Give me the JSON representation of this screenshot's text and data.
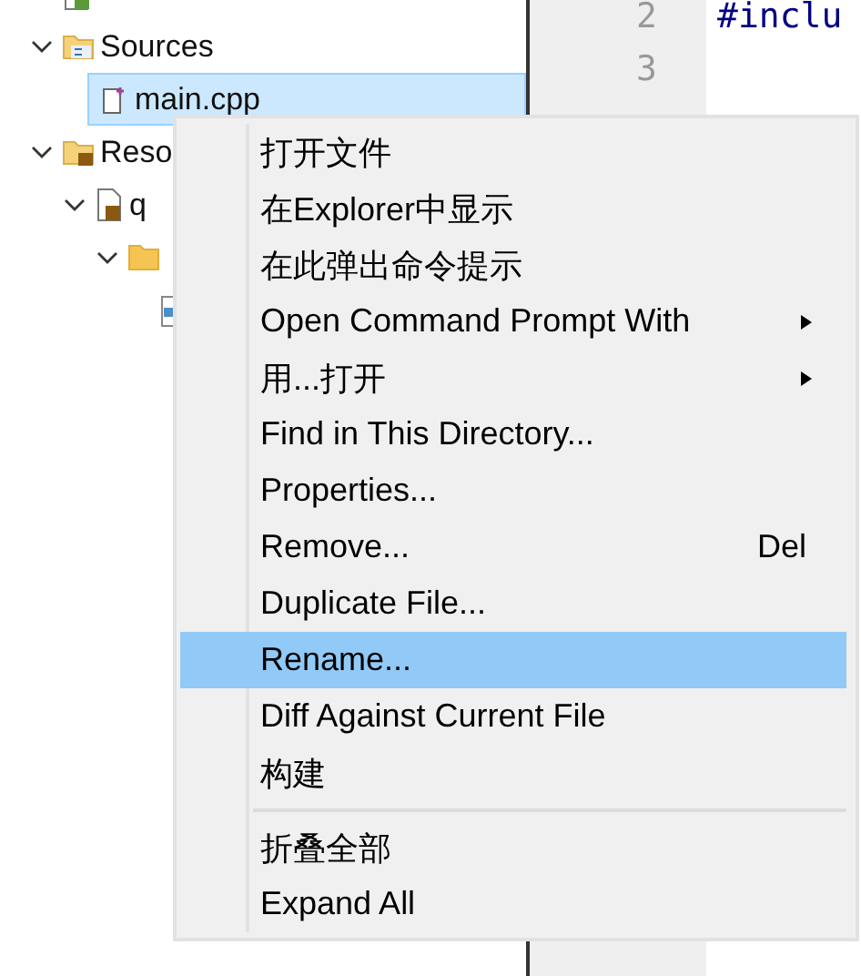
{
  "tree": [
    {
      "kind": "project",
      "selected": false
    },
    {
      "kind": "source-folder",
      "label": "Sources",
      "expanded": true,
      "selected": false,
      "children": [
        {
          "kind": "source-file",
          "label": "main.cpp",
          "selected": true
        }
      ]
    },
    {
      "kind": "resource-folder",
      "label": "Reso",
      "expanded": true,
      "selected": false,
      "children": [
        {
          "kind": "resource-file",
          "label": "q",
          "expanded": true,
          "selected": false,
          "children": [
            {
              "kind": "folder",
              "expanded": true,
              "selected": false,
              "children": [
                {
                  "kind": "image",
                  "selected": false
                }
              ]
            }
          ]
        }
      ]
    }
  ],
  "editor": {
    "lines": [
      {
        "number": "2",
        "code": "#inclu"
      },
      {
        "number": "3"
      }
    ]
  },
  "context_menu": [
    {
      "kind": "item",
      "label": "打开文件",
      "selected": false
    },
    {
      "kind": "item",
      "label": "在Explorer中显示",
      "selected": false
    },
    {
      "kind": "item",
      "label": "在此弹出命令提示",
      "selected": false
    },
    {
      "kind": "submenu",
      "label": "Open Command Prompt With",
      "selected": false
    },
    {
      "kind": "submenu",
      "label": "用...打开",
      "selected": false
    },
    {
      "kind": "item",
      "label": "Find in This Directory...",
      "selected": false
    },
    {
      "kind": "item",
      "label": "Properties...",
      "selected": false
    },
    {
      "kind": "item",
      "label": "Remove...",
      "shortcut": "Del",
      "selected": false
    },
    {
      "kind": "item",
      "label": "Duplicate File...",
      "selected": false
    },
    {
      "kind": "item",
      "label": "Rename...",
      "selected": true
    },
    {
      "kind": "item",
      "label": "Diff Against Current File",
      "selected": false
    },
    {
      "kind": "item",
      "label": "构建",
      "selected": false
    },
    {
      "kind": "separator"
    },
    {
      "kind": "item",
      "label": "折叠全部",
      "selected": false
    },
    {
      "kind": "item",
      "label": "Expand All",
      "selected": false
    }
  ]
}
